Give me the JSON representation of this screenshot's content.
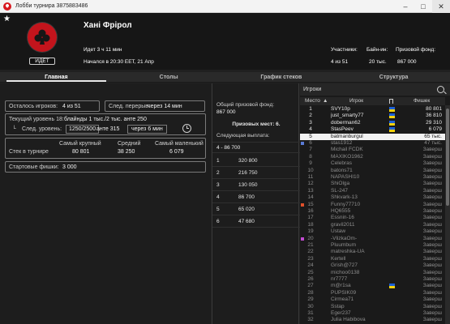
{
  "window": {
    "title": "Лобби турнира 3875883486",
    "minimize": "–",
    "maximize": "□",
    "close": "✕"
  },
  "header": {
    "favorite_icon": "star-icon",
    "tournament_name": "Хані Фрірол",
    "status_badge": "ИДЁТ",
    "running_time": "Идет 3 ч 11 мин",
    "started": "Начался в 20:30 EET, 21 Апр",
    "participants_label": "Участники:",
    "participants_value": "4 из 51",
    "buyin_label": "Байн-ин:",
    "buyin_value": "20 тыс.",
    "prize_label": "Призовой фонд:",
    "prize_value": "867 000"
  },
  "tabs": [
    "Главная",
    "Столы",
    "График стеков",
    "Структура"
  ],
  "main": {
    "players_left_label": "Осталось игроков:",
    "players_left_value": "4 из 51",
    "next_break_label": "След. перерыв:",
    "next_break_value": "через 14 мин",
    "current_level_label": "Текущий уровень 18:",
    "current_level_value": "блайнды 1 тыс./2 тыс. анте 250",
    "next_level_label": "След. уровень:",
    "next_level_blinds": "1250/2500",
    "next_level_ante": "анте 315",
    "next_level_in": "через 6 мин",
    "stacks_label": "Стек в турнире",
    "stack_largest_label": "Самый крупный",
    "stack_largest_value": "80 801",
    "stack_avg_label": "Средний",
    "stack_avg_value": "38 250",
    "stack_smallest_label": "Самый маленький",
    "stack_smallest_value": "6 079",
    "starting_chips_label": "Стартовые фишки:",
    "starting_chips_value": "3 000"
  },
  "prizes": {
    "pool_label": "Общий призовой фонд:",
    "pool_value": "867 000",
    "places_label": "Призовых мест: 6.",
    "next_payout_label": "Следующая выплата:",
    "next_payout_value": "4 - 86 700",
    "rows": [
      {
        "place": "1",
        "amount": "320 800"
      },
      {
        "place": "2",
        "amount": "216 750"
      },
      {
        "place": "3",
        "amount": "130 050"
      },
      {
        "place": "4",
        "amount": "86 700"
      },
      {
        "place": "5",
        "amount": "65 020"
      },
      {
        "place": "6",
        "amount": "47 680"
      }
    ]
  },
  "players": {
    "title": "Игроки",
    "col_place": "Место",
    "col_player": "Игрок",
    "col_chips": "Фишек",
    "rows": [
      {
        "place": "1",
        "name": "SVY10p",
        "chips": "80 801",
        "state": "active"
      },
      {
        "place": "2",
        "name": "just_smarty77",
        "chips": "36 810",
        "state": "active"
      },
      {
        "place": "3",
        "name": "doberman62",
        "chips": "29 310",
        "state": "active"
      },
      {
        "place": "4",
        "name": "StasPeev",
        "chips": "6 079",
        "state": "active"
      },
      {
        "place": "5",
        "name": "batmanburgul",
        "chips": "65 тыс.",
        "state": "me"
      },
      {
        "place": "6",
        "name": "stas1912",
        "chips": "47 тыс.",
        "state": "out"
      },
      {
        "place": "7",
        "name": "Michail FCDK",
        "chips": "Заверш",
        "state": "out"
      },
      {
        "place": "8",
        "name": "MAXIKO1962",
        "chips": "Заверш",
        "state": "out"
      },
      {
        "place": "9",
        "name": "Celebras",
        "chips": "Заверш",
        "state": "out"
      },
      {
        "place": "10",
        "name": "batons71",
        "chips": "Заверш",
        "state": "out"
      },
      {
        "place": "11",
        "name": "NAPASHI10",
        "chips": "Заверш",
        "state": "out"
      },
      {
        "place": "12",
        "name": "ShiOlga",
        "chips": "Заверш",
        "state": "out"
      },
      {
        "place": "13",
        "name": "SL-247",
        "chips": "Заверш",
        "state": "out"
      },
      {
        "place": "14",
        "name": "Shkvark-13",
        "chips": "Заверш",
        "state": "out"
      },
      {
        "place": "15",
        "name": "Funny77710",
        "chips": "Заверш",
        "state": "out"
      },
      {
        "place": "16",
        "name": "HQ6555",
        "chips": "Заверш",
        "state": "out"
      },
      {
        "place": "17",
        "name": "Essnin-16",
        "chips": "Заверш",
        "state": "out"
      },
      {
        "place": "18",
        "name": "gravil2011",
        "chips": "Заверш",
        "state": "out"
      },
      {
        "place": "19",
        "name": "Ustaw",
        "chips": "Заверш",
        "state": "out"
      },
      {
        "place": "20",
        "name": "-VlizkaOm-",
        "chips": "Заверш",
        "state": "out"
      },
      {
        "place": "21",
        "name": "Pluumbum",
        "chips": "Заверш",
        "state": "out"
      },
      {
        "place": "22",
        "name": "matreshka-UA",
        "chips": "Заверш",
        "state": "out"
      },
      {
        "place": "23",
        "name": "Kertell",
        "chips": "Заверш",
        "state": "out"
      },
      {
        "place": "24",
        "name": "Grish@727",
        "chips": "Заверш",
        "state": "out"
      },
      {
        "place": "25",
        "name": "michoo0138",
        "chips": "Заверш",
        "state": "out"
      },
      {
        "place": "26",
        "name": "nr7777",
        "chips": "Заверш",
        "state": "out"
      },
      {
        "place": "27",
        "name": "m@r1sa",
        "chips": "Заверш",
        "state": "out"
      },
      {
        "place": "28",
        "name": "PUPSIK09",
        "chips": "Заверш",
        "state": "out"
      },
      {
        "place": "29",
        "name": "Cirmea71",
        "chips": "Заверш",
        "state": "out"
      },
      {
        "place": "30",
        "name": "Sstap",
        "chips": "Заверш",
        "state": "out"
      },
      {
        "place": "31",
        "name": "Eger237",
        "chips": "Заверш",
        "state": "out"
      },
      {
        "place": "32",
        "name": "Julia Habibova",
        "chips": "Заверш",
        "state": "out"
      }
    ]
  },
  "colors": {
    "brand_red": "#c3141c",
    "flag_blue": "#1b5fd6",
    "flag_yellow": "#f4d20c"
  }
}
